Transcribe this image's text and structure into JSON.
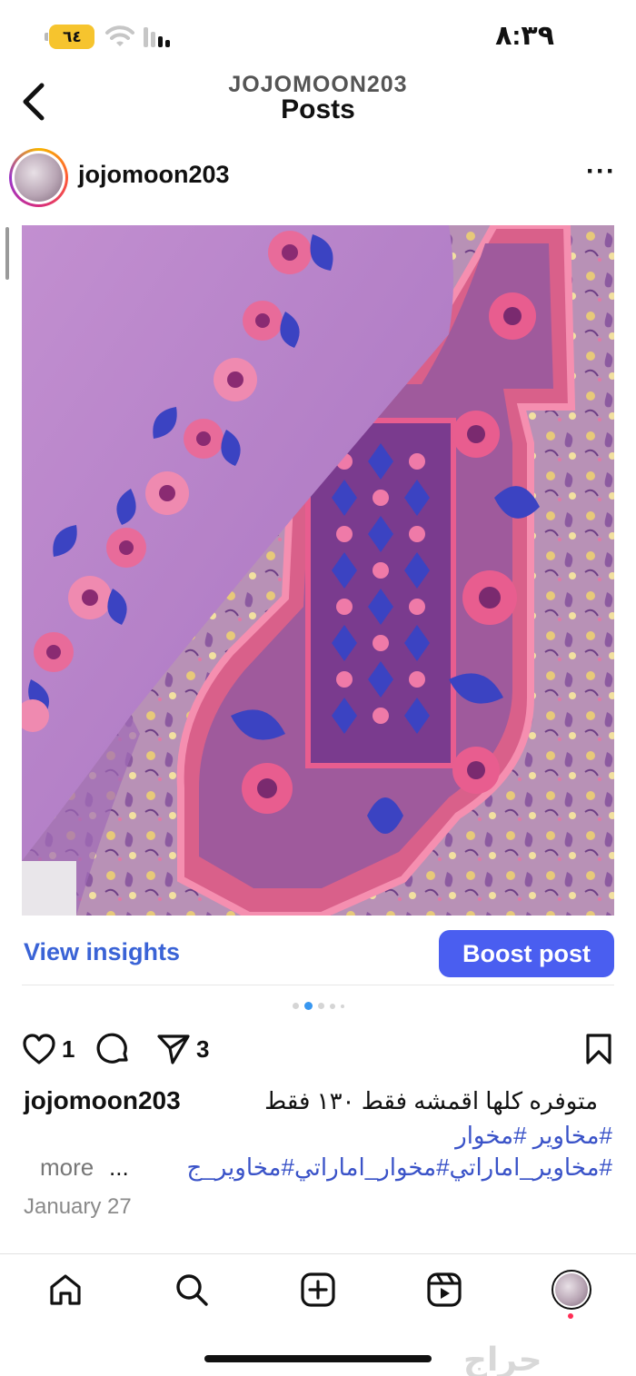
{
  "status_bar": {
    "time": "٨:٣٩",
    "battery": "٦٤"
  },
  "header": {
    "subtitle": "JOJOMOON203",
    "title": "Posts"
  },
  "post": {
    "username": "jojomoon203",
    "image_count": 5,
    "active_image_index": 2,
    "insights_label": "View insights",
    "boost_label": "Boost post",
    "likes": "1",
    "shares": "3",
    "caption_user": "jojomoon203",
    "caption_text": "متوفره كلها اقمشه فقط ١٣٠ فقط",
    "hashtags_line1": "#مخاوير #مخوار",
    "hashtags_line2": "#مخاوير_اماراتي#مخوار_اماراتي#مخاوير_ج",
    "ellipsis": "...",
    "more_label": "more",
    "date": "January 27"
  },
  "tabs": [
    "home-icon",
    "search-icon",
    "create-icon",
    "reels-icon",
    "profile-avatar"
  ],
  "watermark": "حراج",
  "colors": {
    "accent_blue": "#3a63d6",
    "boost_bg": "#4a5ef0",
    "fabric_lilac": "#b784c8",
    "embroidery_pink": "#e2668f",
    "embroidery_blue": "#3b43c2",
    "battery_yellow": "#f6c42e"
  }
}
